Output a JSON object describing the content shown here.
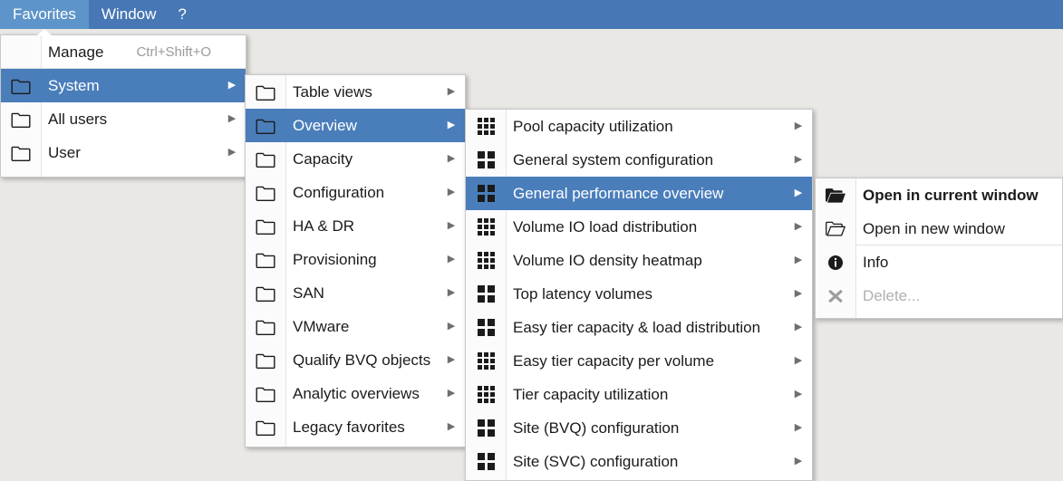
{
  "colors": {
    "menubar_bg": "#4777b4",
    "menubar_active": "#5d94c9",
    "highlight": "#4a7ebb",
    "desktop_bg": "#eae8e5",
    "menu_bg": "#ffffff",
    "text": "#1b1b1b",
    "disabled_text": "#b0b0b0",
    "accel_text": "#9a9a9a"
  },
  "menubar": {
    "items": [
      {
        "label": "Favorites",
        "active": true,
        "name": "menubar-item-favorites"
      },
      {
        "label": "Window",
        "active": false,
        "name": "menubar-item-window"
      },
      {
        "label": "?",
        "active": false,
        "name": "menubar-item-help"
      }
    ]
  },
  "menu1": {
    "name": "favorites-menu",
    "items": [
      {
        "label": "Manage",
        "accel": "Ctrl+Shift+O",
        "icon": "none",
        "arrow": false,
        "selected": false,
        "separator_below": true,
        "name": "menu-item-manage"
      },
      {
        "label": "System",
        "accel": "",
        "icon": "folder",
        "arrow": true,
        "selected": true,
        "separator_below": false,
        "name": "menu-item-system"
      },
      {
        "label": "All users",
        "accel": "",
        "icon": "folder",
        "arrow": true,
        "selected": false,
        "separator_below": false,
        "name": "menu-item-all-users"
      },
      {
        "label": "User",
        "accel": "",
        "icon": "folder",
        "arrow": true,
        "selected": false,
        "separator_below": false,
        "name": "menu-item-user"
      }
    ]
  },
  "menu2": {
    "name": "system-submenu",
    "items": [
      {
        "label": "Table views",
        "icon": "folder",
        "arrow": true,
        "selected": false,
        "name": "menu-item-table-views"
      },
      {
        "label": "Overview",
        "icon": "folder",
        "arrow": true,
        "selected": true,
        "name": "menu-item-overview"
      },
      {
        "label": "Capacity",
        "icon": "folder",
        "arrow": true,
        "selected": false,
        "name": "menu-item-capacity"
      },
      {
        "label": "Configuration",
        "icon": "folder",
        "arrow": true,
        "selected": false,
        "name": "menu-item-configuration"
      },
      {
        "label": "HA & DR",
        "icon": "folder",
        "arrow": true,
        "selected": false,
        "name": "menu-item-ha-dr"
      },
      {
        "label": "Provisioning",
        "icon": "folder",
        "arrow": true,
        "selected": false,
        "name": "menu-item-provisioning"
      },
      {
        "label": "SAN",
        "icon": "folder",
        "arrow": true,
        "selected": false,
        "name": "menu-item-san"
      },
      {
        "label": "VMware",
        "icon": "folder",
        "arrow": true,
        "selected": false,
        "name": "menu-item-vmware"
      },
      {
        "label": "Qualify BVQ objects",
        "icon": "folder",
        "arrow": true,
        "selected": false,
        "name": "menu-item-qualify-bvq-objects"
      },
      {
        "label": "Analytic overviews",
        "icon": "folder",
        "arrow": true,
        "selected": false,
        "name": "menu-item-analytic-overviews"
      },
      {
        "label": "Legacy favorites",
        "icon": "folder",
        "arrow": true,
        "selected": false,
        "name": "menu-item-legacy-favorites"
      }
    ]
  },
  "menu3": {
    "name": "overview-submenu",
    "items": [
      {
        "label": "Pool capacity utilization",
        "icon": "grid9",
        "arrow": true,
        "selected": false,
        "name": "menu-item-pool-capacity-utilization"
      },
      {
        "label": "General system configuration",
        "icon": "grid4",
        "arrow": true,
        "selected": false,
        "name": "menu-item-general-system-configuration"
      },
      {
        "label": "General performance overview",
        "icon": "grid4",
        "arrow": true,
        "selected": true,
        "name": "menu-item-general-performance-overview"
      },
      {
        "label": "Volume IO load distribution",
        "icon": "grid9",
        "arrow": true,
        "selected": false,
        "name": "menu-item-volume-io-load-distribution"
      },
      {
        "label": "Volume IO density heatmap",
        "icon": "grid9",
        "arrow": true,
        "selected": false,
        "name": "menu-item-volume-io-density-heatmap"
      },
      {
        "label": "Top latency volumes",
        "icon": "grid4",
        "arrow": true,
        "selected": false,
        "name": "menu-item-top-latency-volumes"
      },
      {
        "label": "Easy tier capacity & load distribution",
        "icon": "grid4",
        "arrow": true,
        "selected": false,
        "name": "menu-item-easy-tier-capacity-load-distribution"
      },
      {
        "label": "Easy tier capacity per volume",
        "icon": "grid9",
        "arrow": true,
        "selected": false,
        "name": "menu-item-easy-tier-capacity-per-volume"
      },
      {
        "label": "Tier capacity utilization",
        "icon": "grid9",
        "arrow": true,
        "selected": false,
        "name": "menu-item-tier-capacity-utilization"
      },
      {
        "label": "Site (BVQ) configuration",
        "icon": "grid4",
        "arrow": true,
        "selected": false,
        "name": "menu-item-site-bvq-configuration"
      },
      {
        "label": "Site (SVC) configuration",
        "icon": "grid4",
        "arrow": true,
        "selected": false,
        "name": "menu-item-site-svc-configuration"
      }
    ]
  },
  "menu4": {
    "name": "favorite-context-menu",
    "items": [
      {
        "label": "Open in current window",
        "icon": "folder-open-filled",
        "bold": true,
        "disabled": false,
        "separator_below": false,
        "name": "menu-item-open-in-current-window"
      },
      {
        "label": "Open in new window",
        "icon": "folder-open-outline",
        "bold": false,
        "disabled": false,
        "separator_below": true,
        "name": "menu-item-open-in-new-window"
      },
      {
        "label": "Info",
        "icon": "info-icon",
        "bold": false,
        "disabled": false,
        "separator_below": false,
        "name": "menu-item-info"
      },
      {
        "label": "Delete...",
        "icon": "delete-x-icon",
        "bold": false,
        "disabled": true,
        "separator_below": false,
        "name": "menu-item-delete"
      }
    ]
  }
}
